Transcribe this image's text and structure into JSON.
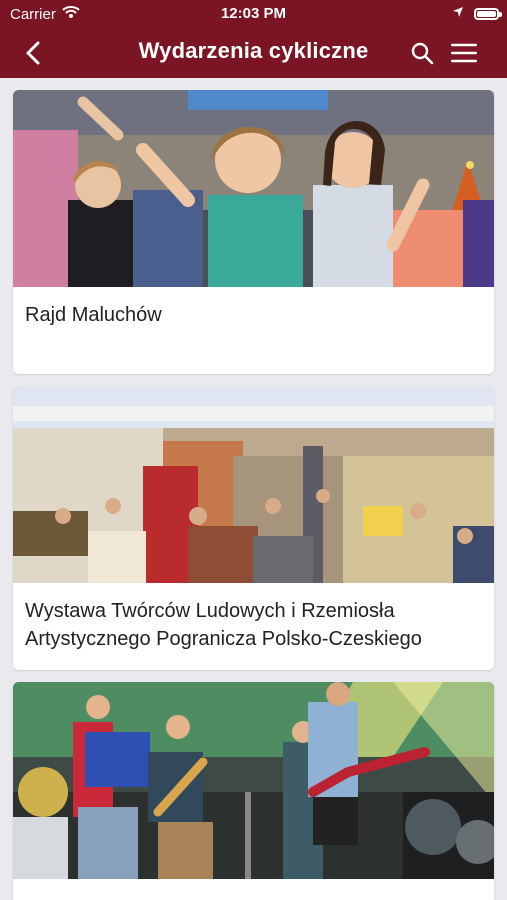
{
  "status": {
    "carrier": "Carrier",
    "time": "12:03 PM"
  },
  "nav": {
    "title": "Wydarzenia cykliczne"
  },
  "colors": {
    "header": "#7b1523",
    "background": "#e9e9ee",
    "card": "#ffffff"
  },
  "events": [
    {
      "title": "Rajd Maluchów",
      "image": "children-crowd-photo"
    },
    {
      "title": "Wystawa Twórców Ludowych i Rzemiosła Artystycznego Pogranicza Polsko-Czeskiego",
      "image": "craft-fair-hall-photo"
    },
    {
      "title": "",
      "image": "concert-stage-band-photo"
    }
  ]
}
